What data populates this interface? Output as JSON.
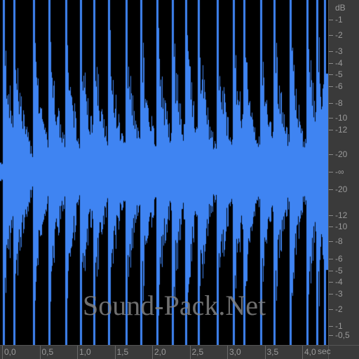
{
  "waveform": {
    "color": "#3f84f2",
    "background": "#000000",
    "onset_times_sec": [
      0.02,
      0.16,
      0.42,
      0.63,
      0.85,
      1.05,
      1.22,
      1.42,
      1.65,
      1.85,
      2.07,
      2.27,
      2.45,
      2.62,
      2.87,
      3.08,
      3.22,
      3.45,
      3.63,
      3.84,
      4.07,
      4.2,
      4.3
    ]
  },
  "db_scale": {
    "unit_label": "dB",
    "labels_top": [
      "-1",
      "-2",
      "-3",
      "-4",
      "-5",
      "-6",
      "-8",
      "-10",
      "-12",
      "-20"
    ],
    "center_label": "-∞",
    "labels_bottom": [
      "-20",
      "-12",
      "-10",
      "-8",
      "-6",
      "-5",
      "-4",
      "-3",
      "-2",
      "-1",
      "-0,5"
    ]
  },
  "time_scale": {
    "labels": [
      "0,0",
      "0,5",
      "1,0",
      "1,5",
      "2,0",
      "2,5",
      "3,0",
      "3,5",
      "4,0"
    ],
    "unit_label": "sec",
    "duration_sec": 4.3
  },
  "watermark": "Sound-Pack.Net"
}
